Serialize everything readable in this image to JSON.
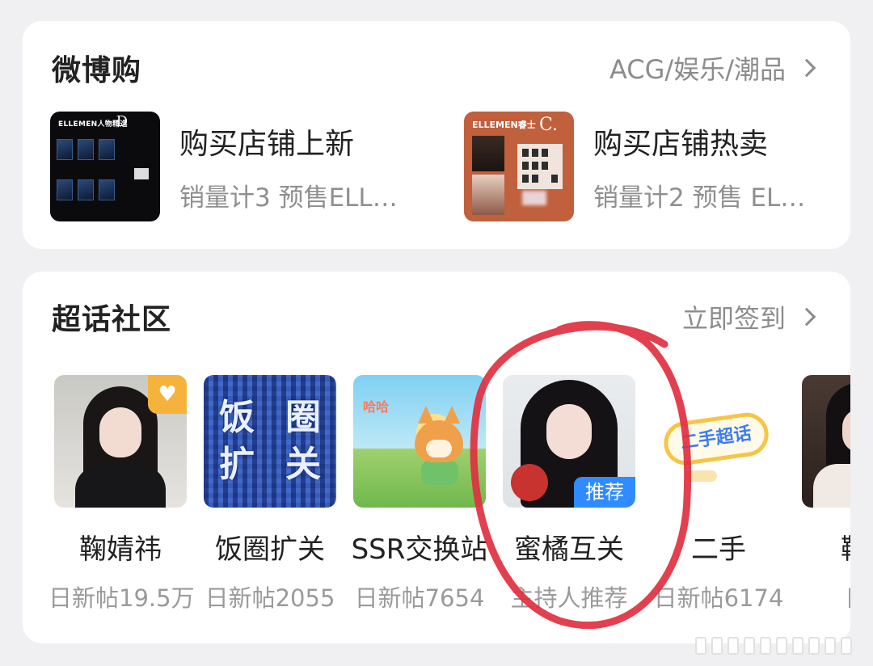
{
  "shop": {
    "title": "微博购",
    "link": "ACG/娱乐/潮品",
    "items": [
      {
        "name": "购买店铺上新",
        "sub": "销量计3 预售ELL…",
        "thumb_brand": "ELLEMEN人物精选",
        "thumb_letter": "D"
      },
      {
        "name": "购买店铺热卖",
        "sub": "销量计2 预售 EL…",
        "thumb_brand": "ELLEMEN睿士",
        "thumb_letter": "C."
      }
    ]
  },
  "super_topic": {
    "title": "超话社区",
    "link": "立即签到",
    "tiles": [
      {
        "name": "鞠婧祎",
        "sub": "日新帖19.5万",
        "image": "portrait-photo"
      },
      {
        "name": "饭圈扩关",
        "sub": "日新帖2055",
        "image": "plaid-text-art",
        "art_chars": [
          "饭",
          "圈",
          "扩",
          "关"
        ]
      },
      {
        "name": "SSR交换站",
        "sub": "日新帖7654",
        "image": "corgi-cartoon",
        "art_text": "哈哈"
      },
      {
        "name": "蜜橘互关",
        "sub": "主持人推荐",
        "image": "portrait-photo",
        "badge": "推荐"
      },
      {
        "name": "二手",
        "sub": "日新帖6174",
        "image": "second-hand-logo",
        "art_text": "二手超话"
      },
      {
        "name": "鞠婧",
        "sub": "日新",
        "image": "portrait-photo"
      }
    ]
  },
  "colors": {
    "background": "#f0f0f2",
    "card": "#ffffff",
    "primary_text": "#222222",
    "secondary_text": "#8c8c8c",
    "badge_blue": "#2f8bff",
    "annotation_red": "#e0303f"
  }
}
